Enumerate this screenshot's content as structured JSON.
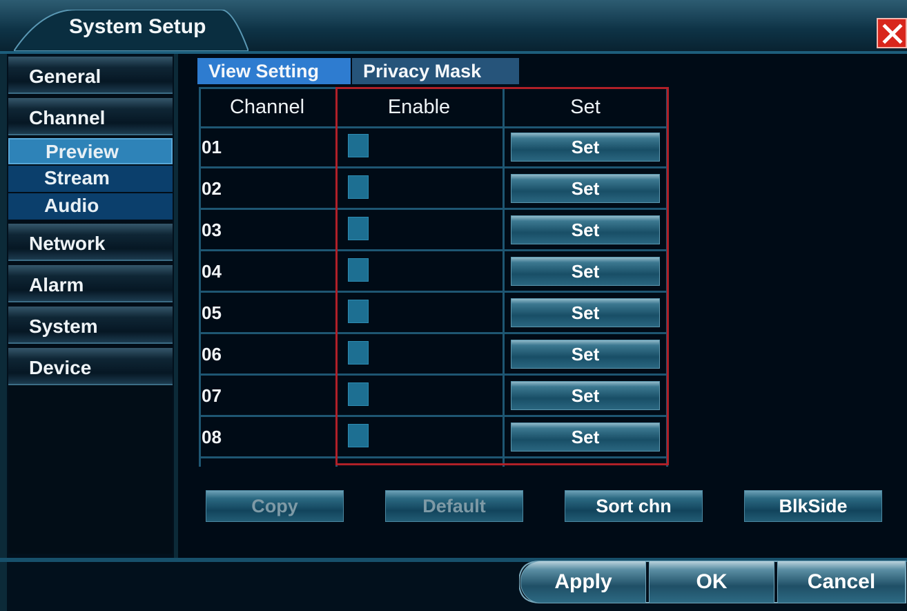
{
  "window": {
    "title": "System Setup"
  },
  "sidebar": {
    "items": [
      {
        "label": "General"
      },
      {
        "label": "Channel"
      },
      {
        "label": "Network"
      },
      {
        "label": "Alarm"
      },
      {
        "label": "System"
      },
      {
        "label": "Device"
      }
    ],
    "subitems": [
      {
        "label": "Preview",
        "active": true
      },
      {
        "label": "Stream",
        "active": false
      },
      {
        "label": "Audio",
        "active": false
      }
    ]
  },
  "tabs": [
    {
      "label": "View Setting",
      "active": true
    },
    {
      "label": "Privacy Mask",
      "active": false
    }
  ],
  "table": {
    "headers": [
      "Channel",
      "Enable",
      "Set"
    ],
    "rows": [
      {
        "channel": "01",
        "enabled": false,
        "set_label": "Set"
      },
      {
        "channel": "02",
        "enabled": false,
        "set_label": "Set"
      },
      {
        "channel": "03",
        "enabled": false,
        "set_label": "Set"
      },
      {
        "channel": "04",
        "enabled": false,
        "set_label": "Set"
      },
      {
        "channel": "05",
        "enabled": false,
        "set_label": "Set"
      },
      {
        "channel": "06",
        "enabled": false,
        "set_label": "Set"
      },
      {
        "channel": "07",
        "enabled": false,
        "set_label": "Set"
      },
      {
        "channel": "08",
        "enabled": false,
        "set_label": "Set"
      }
    ]
  },
  "actions": [
    {
      "label": "Copy",
      "enabled": false
    },
    {
      "label": "Default",
      "enabled": false
    },
    {
      "label": "Sort chn",
      "enabled": true
    },
    {
      "label": "BlkSide",
      "enabled": true
    }
  ],
  "footer": {
    "apply_label": "Apply",
    "ok_label": "OK",
    "cancel_label": "Cancel"
  },
  "colors": {
    "background": "#02101c",
    "active_tab": "#2e7cd0",
    "highlight_border": "#b02028",
    "close_button": "#d8261c"
  },
  "icons": {
    "close": "close-icon"
  }
}
